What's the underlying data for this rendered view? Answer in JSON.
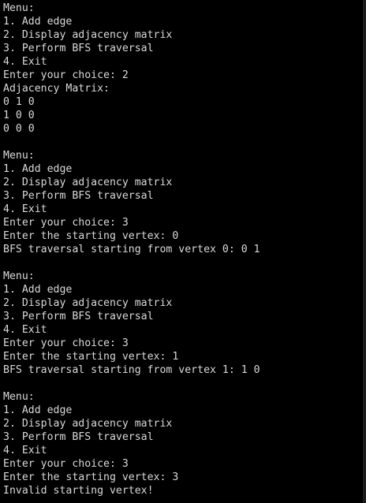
{
  "terminal": {
    "lines": [
      "Menu:",
      "1. Add edge",
      "2. Display adjacency matrix",
      "3. Perform BFS traversal",
      "4. Exit",
      "Enter your choice: 2",
      "Adjacency Matrix:",
      "0 1 0",
      "1 0 0",
      "0 0 0",
      "",
      "Menu:",
      "1. Add edge",
      "2. Display adjacency matrix",
      "3. Perform BFS traversal",
      "4. Exit",
      "Enter your choice: 3",
      "Enter the starting vertex: 0",
      "BFS traversal starting from vertex 0: 0 1",
      "",
      "Menu:",
      "1. Add edge",
      "2. Display adjacency matrix",
      "3. Perform BFS traversal",
      "4. Exit",
      "Enter your choice: 3",
      "Enter the starting vertex: 1",
      "BFS traversal starting from vertex 1: 1 0",
      "",
      "Menu:",
      "1. Add edge",
      "2. Display adjacency matrix",
      "3. Perform BFS traversal",
      "4. Exit",
      "Enter your choice: 3",
      "Enter the starting vertex: 3",
      "Invalid starting vertex!"
    ],
    "text_color": "#d9d9d9",
    "background_color": "#000000"
  }
}
